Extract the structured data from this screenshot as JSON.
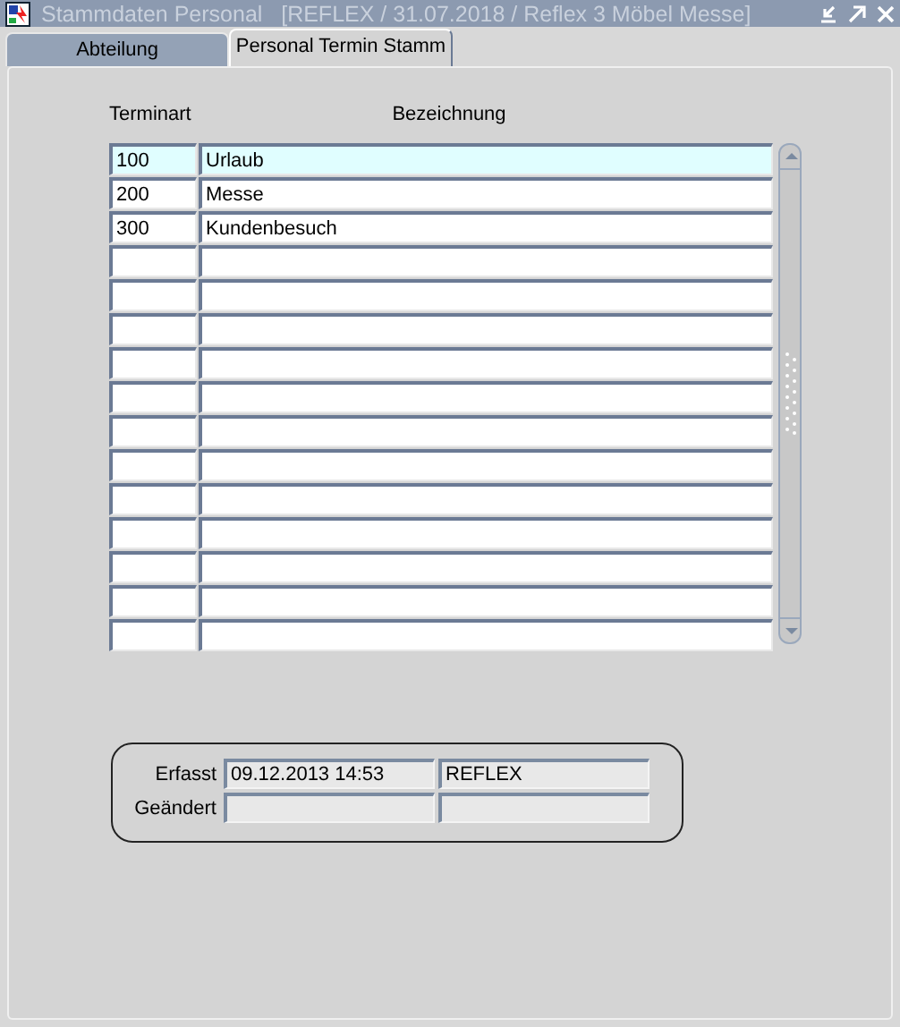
{
  "window": {
    "title": "Stammdaten Personal   [REFLEX / 31.07.2018 / Reflex 3 Möbel Messe]"
  },
  "tabs": [
    {
      "label": "Abteilung",
      "selected": false
    },
    {
      "label": "Personal Termin Stamm",
      "selected": true
    }
  ],
  "table": {
    "columns": [
      "Terminart",
      "Bezeichnung"
    ],
    "rows": [
      {
        "terminart": "100",
        "bezeichnung": "Urlaub",
        "selected": true
      },
      {
        "terminart": "200",
        "bezeichnung": "Messe",
        "selected": false
      },
      {
        "terminart": "300",
        "bezeichnung": "Kundenbesuch",
        "selected": false
      },
      {
        "selected": false
      },
      {
        "selected": false
      },
      {
        "selected": false
      },
      {
        "selected": false
      },
      {
        "selected": false
      },
      {
        "selected": false
      },
      {
        "selected": false
      },
      {
        "selected": false
      },
      {
        "selected": false
      },
      {
        "selected": false
      },
      {
        "selected": false
      },
      {
        "selected": false
      }
    ]
  },
  "audit": [
    {
      "label": "Erfasst",
      "date": "09.12.2013 14:53",
      "user": "REFLEX"
    },
    {
      "label": "Geändert"
    }
  ]
}
